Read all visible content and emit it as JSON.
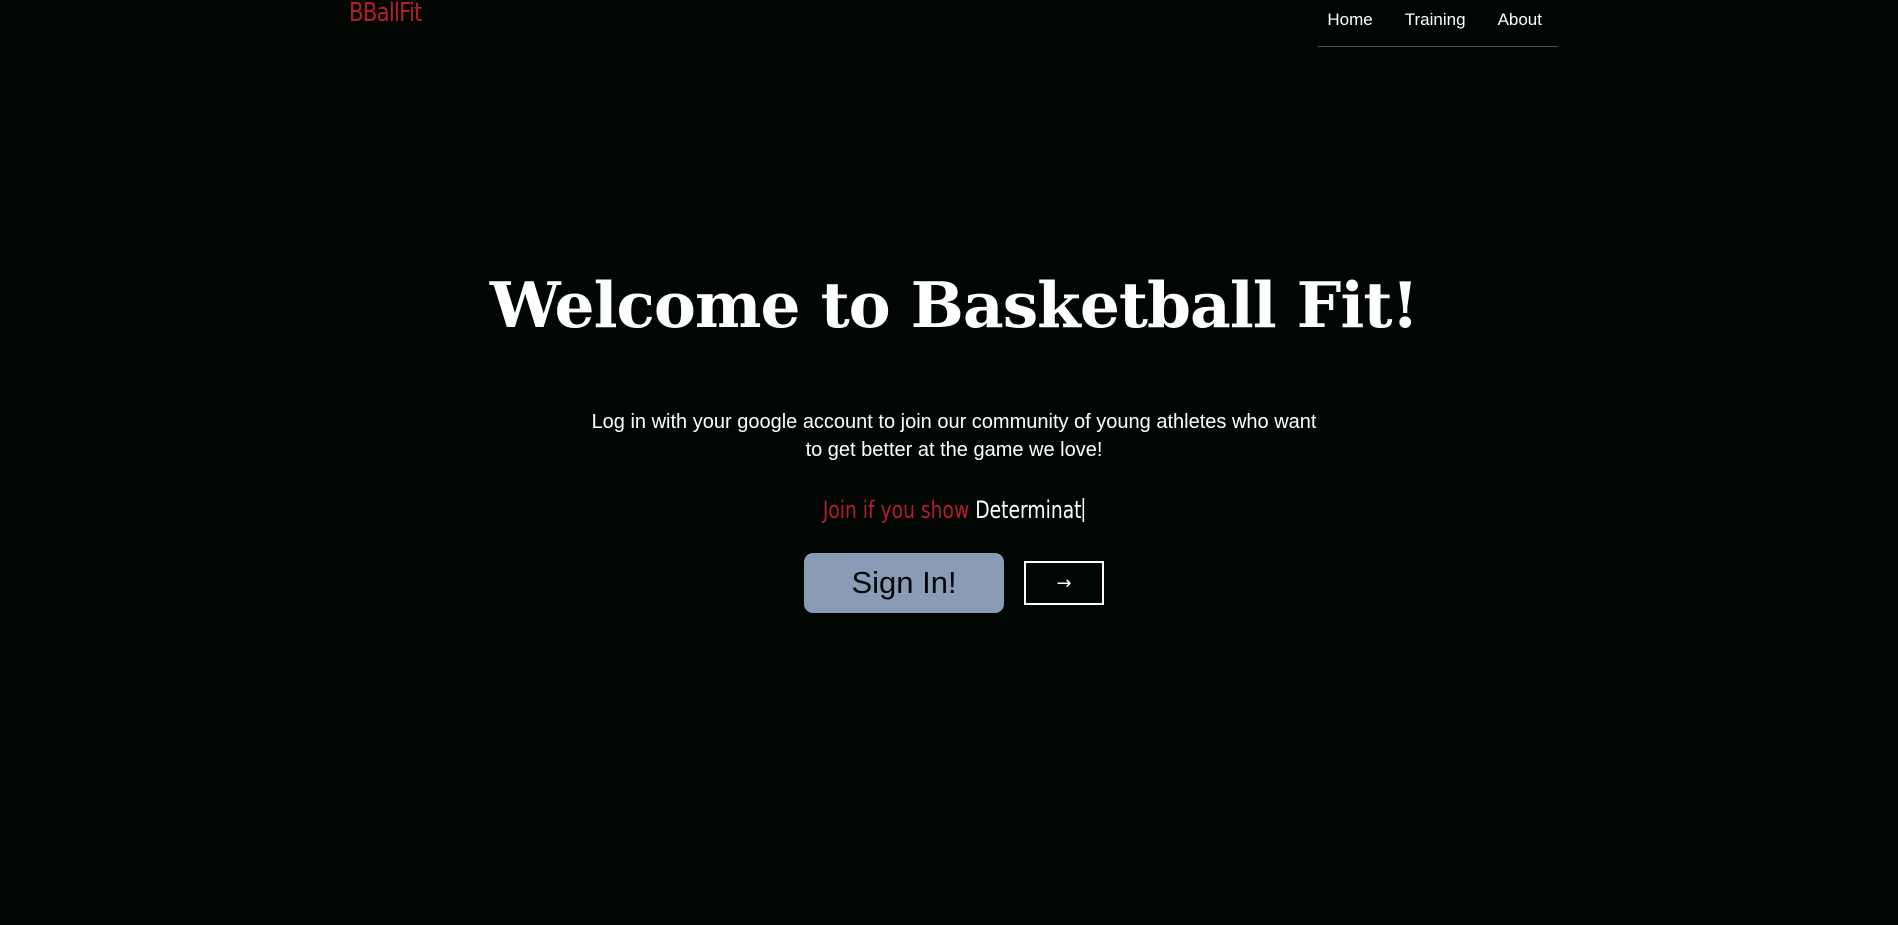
{
  "brand": {
    "name": "BBallFit"
  },
  "nav": {
    "items": [
      {
        "label": "Home"
      },
      {
        "label": "Training"
      },
      {
        "label": "About"
      }
    ]
  },
  "hero": {
    "title": "Welcome to Basketball Fit!",
    "subtitle": "Log in with your google account to join our community of young athletes who want to get better at the game we love!",
    "typed_prefix": "Join if you show",
    "typed_word": "Determinat",
    "signin_label": "Sign In!",
    "arrow_icon": "→"
  },
  "colors": {
    "background": "#010602",
    "brand_red": "#b01f2a",
    "button_fill": "#8a9bb5",
    "text": "#ffffff"
  }
}
